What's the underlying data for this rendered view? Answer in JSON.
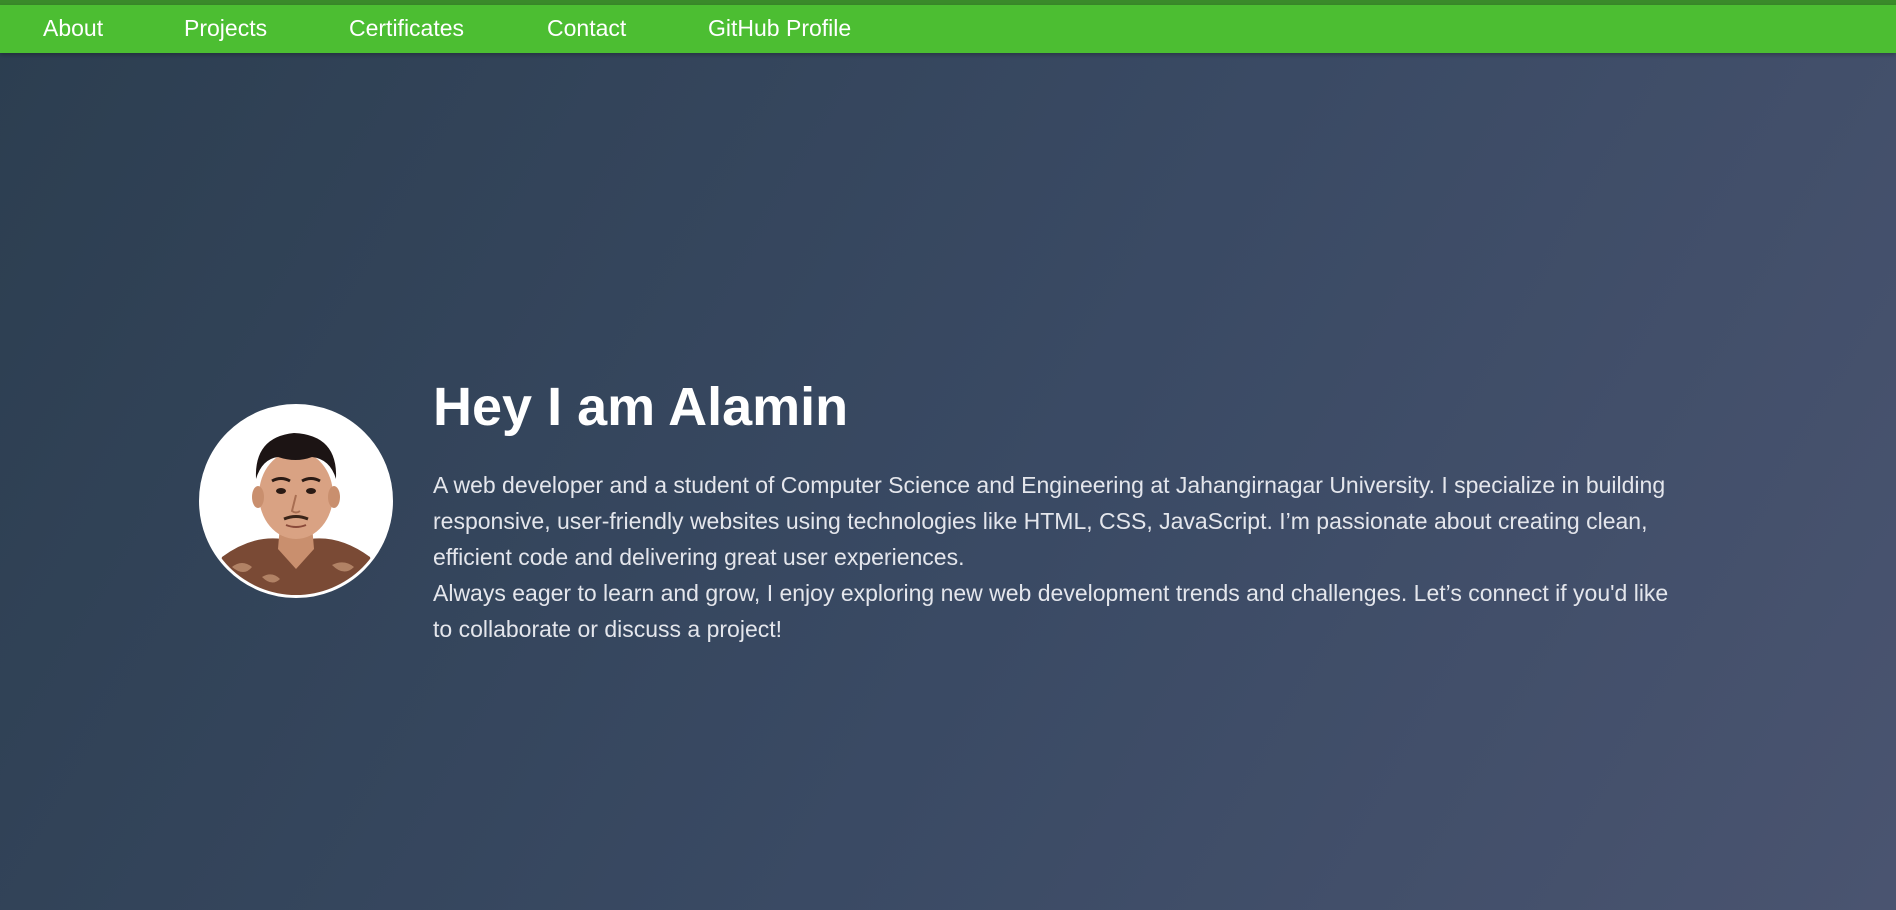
{
  "nav": {
    "items": [
      {
        "label": "About"
      },
      {
        "label": "Projects"
      },
      {
        "label": "Certificates"
      },
      {
        "label": "Contact"
      },
      {
        "label": "GitHub Profile"
      }
    ]
  },
  "hero": {
    "title": "Hey I am Alamin",
    "paragraph1": "A web developer and a student of Computer Science and Engineering at Jahangirnagar University. I specialize in building responsive, user-friendly websites using technologies like HTML, CSS, JavaScript. I’m passionate about creating clean, efficient code and delivering great user experiences.",
    "paragraph2": "Always eager to learn and grow, I enjoy exploring new web development trends and challenges. Let’s connect if you'd like to collaborate or discuss a project!"
  },
  "colors": {
    "navbar": "#4cbe32",
    "background_start": "#2c3e50",
    "background_end": "#4a5470",
    "text": "#ffffff"
  }
}
